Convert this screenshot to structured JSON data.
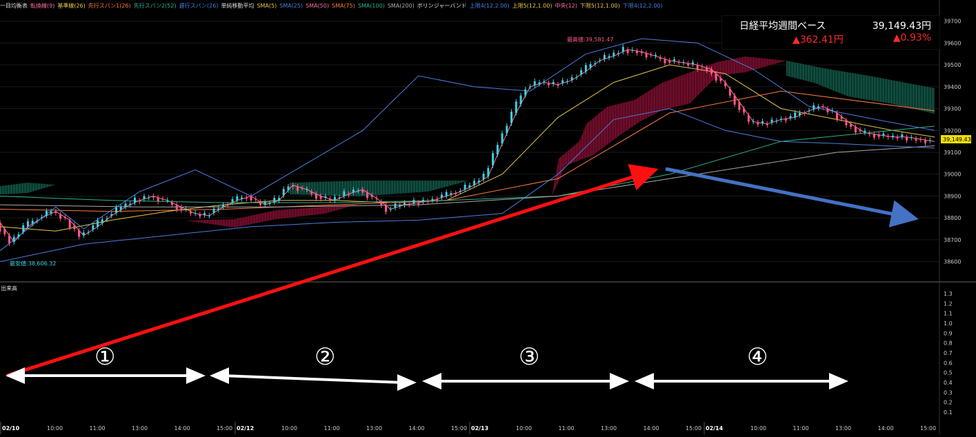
{
  "legend": [
    {
      "text": "一目均衡表",
      "color": "#dddddd"
    },
    {
      "text": "転換線(9)",
      "color": "#ff6fa0"
    },
    {
      "text": "基準線(26)",
      "color": "#e6c84a"
    },
    {
      "text": "先行スパン1(26)",
      "color": "#ff7a3c"
    },
    {
      "text": "先行スパン2(52)",
      "color": "#2fb58a"
    },
    {
      "text": "遅行スパン(26)",
      "color": "#4a7fe0"
    },
    {
      "text": "単純移動平均",
      "color": "#dddddd"
    },
    {
      "text": "SMA(5)",
      "color": "#e6c84a"
    },
    {
      "text": "SMA(25)",
      "color": "#4a7fe0"
    },
    {
      "text": "SMA(50)",
      "color": "#ff6fa0"
    },
    {
      "text": "SMA(75)",
      "color": "#ff7a3c"
    },
    {
      "text": "SMA(100)",
      "color": "#2fb58a"
    },
    {
      "text": "SMA(200)",
      "color": "#aaaaaa"
    },
    {
      "text": "ボリンジャーバンド",
      "color": "#dddddd"
    },
    {
      "text": "上限4(12,2.00)",
      "color": "#4a7fe0"
    },
    {
      "text": "上限5(12,1.00)",
      "color": "#e6c84a"
    },
    {
      "text": "中央(12)",
      "color": "#ff6fa0"
    },
    {
      "text": "下限5(12,1.00)",
      "color": "#e6c84a"
    },
    {
      "text": "下限4(12,2.00)",
      "color": "#4a7fe0"
    }
  ],
  "info": {
    "title": "日経平均週間ベース",
    "price": "39,149.43円",
    "change": "▲362.41円",
    "change_pct": "▲0.93%"
  },
  "volume_label": "出来高",
  "annotations": {
    "high": "最高値:39,581.47",
    "low": "最安値:38,606.32",
    "current": "39,149.43"
  },
  "segment_labels": [
    "①",
    "②",
    "③",
    "④"
  ],
  "chart_data": {
    "type": "line",
    "price_axis": {
      "ticks": [
        38600,
        38700,
        38800,
        38900,
        39000,
        39100,
        39200,
        39300,
        39400,
        39500,
        39600,
        39700
      ],
      "ylim": [
        38520,
        39740
      ]
    },
    "volume_axis": {
      "ticks": [
        "0.1",
        "0.2",
        "0.3",
        "0.4",
        "0.5",
        "0.6",
        "0.7",
        "0.8",
        "0.9",
        "1.0",
        "1.1",
        "1.2",
        "1.3"
      ]
    },
    "x_labels": [
      "02/10",
      "10:00",
      "11:00",
      "13:00",
      "14:00",
      "15:00",
      "02/12",
      "10:00",
      "11:00",
      "13:00",
      "14:00",
      "15:00",
      "02/13",
      "10:00",
      "11:00",
      "13:00",
      "14:00",
      "15:00",
      "02/14",
      "10:00",
      "11:00",
      "13:00",
      "14:00",
      "15:00"
    ],
    "series": [
      {
        "color": "#ff6fa0",
        "points": [
          [
            0,
            38780
          ],
          [
            1,
            38690
          ],
          [
            2,
            38760
          ],
          [
            3,
            38800
          ],
          [
            4,
            38830
          ],
          [
            5,
            38790
          ],
          [
            6,
            38720
          ],
          [
            7,
            38760
          ],
          [
            8,
            38810
          ],
          [
            9,
            38850
          ],
          [
            10,
            38880
          ],
          [
            11,
            38900
          ],
          [
            12,
            38880
          ],
          [
            13,
            38850
          ],
          [
            14,
            38820
          ],
          [
            15,
            38810
          ],
          [
            16,
            38850
          ],
          [
            17,
            38880
          ],
          [
            18,
            38900
          ],
          [
            19,
            38860
          ],
          [
            20,
            38880
          ],
          [
            21,
            38950
          ],
          [
            22,
            38930
          ],
          [
            23,
            38900
          ],
          [
            24,
            38880
          ],
          [
            25,
            38910
          ],
          [
            26,
            38930
          ],
          [
            27,
            38890
          ],
          [
            28,
            38840
          ],
          [
            29,
            38860
          ],
          [
            30,
            38870
          ],
          [
            31,
            38880
          ],
          [
            32,
            38900
          ],
          [
            33,
            38920
          ],
          [
            34,
            38950
          ],
          [
            35,
            38990
          ],
          [
            36,
            39140
          ],
          [
            37,
            39280
          ],
          [
            38,
            39400
          ],
          [
            39,
            39420
          ],
          [
            40,
            39410
          ],
          [
            41,
            39430
          ],
          [
            42,
            39470
          ],
          [
            43,
            39520
          ],
          [
            44,
            39540
          ],
          [
            45,
            39570
          ],
          [
            46,
            39560
          ],
          [
            47,
            39540
          ],
          [
            48,
            39520
          ],
          [
            49,
            39510
          ],
          [
            50,
            39500
          ],
          [
            51,
            39480
          ],
          [
            52,
            39420
          ],
          [
            53,
            39330
          ],
          [
            54,
            39240
          ],
          [
            55,
            39230
          ],
          [
            56,
            39250
          ],
          [
            57,
            39260
          ],
          [
            58,
            39290
          ],
          [
            59,
            39310
          ],
          [
            60,
            39280
          ],
          [
            61,
            39230
          ],
          [
            62,
            39190
          ],
          [
            63,
            39180
          ],
          [
            64,
            39170
          ],
          [
            65,
            39170
          ],
          [
            66,
            39160
          ],
          [
            67,
            39150
          ]
        ]
      },
      {
        "color": "#e6c84a",
        "points": [
          [
            0,
            38760
          ],
          [
            4,
            38740
          ],
          [
            8,
            38790
          ],
          [
            12,
            38830
          ],
          [
            16,
            38860
          ],
          [
            20,
            38880
          ],
          [
            24,
            38880
          ],
          [
            28,
            38870
          ],
          [
            32,
            38880
          ],
          [
            36,
            39000
          ],
          [
            40,
            39260
          ],
          [
            44,
            39420
          ],
          [
            48,
            39500
          ],
          [
            52,
            39460
          ],
          [
            56,
            39300
          ],
          [
            60,
            39250
          ],
          [
            64,
            39200
          ],
          [
            67,
            39170
          ]
        ]
      },
      {
        "color": "#ff7a3c",
        "points": [
          [
            0,
            38840
          ],
          [
            8,
            38830
          ],
          [
            16,
            38840
          ],
          [
            24,
            38860
          ],
          [
            32,
            38880
          ],
          [
            40,
            38980
          ],
          [
            48,
            39280
          ],
          [
            56,
            39380
          ],
          [
            67,
            39290
          ]
        ]
      },
      {
        "color": "#2fb58a",
        "points": [
          [
            0,
            38900
          ],
          [
            8,
            38880
          ],
          [
            16,
            38870
          ],
          [
            24,
            38870
          ],
          [
            32,
            38880
          ],
          [
            40,
            38900
          ],
          [
            48,
            39000
          ],
          [
            56,
            39150
          ],
          [
            67,
            39220
          ]
        ]
      },
      {
        "color": "#aaaaaa",
        "points": [
          [
            0,
            38860
          ],
          [
            10,
            38850
          ],
          [
            20,
            38850
          ],
          [
            30,
            38860
          ],
          [
            40,
            38900
          ],
          [
            48,
            38980
          ],
          [
            54,
            39040
          ],
          [
            60,
            39100
          ],
          [
            67,
            39130
          ]
        ]
      },
      {
        "color": "#4a7fe0",
        "points": [
          [
            0,
            38650
          ],
          [
            4,
            38850
          ],
          [
            6,
            38750
          ],
          [
            10,
            38920
          ],
          [
            14,
            39020
          ],
          [
            18,
            38900
          ],
          [
            22,
            39050
          ],
          [
            26,
            39200
          ],
          [
            30,
            39450
          ],
          [
            34,
            39400
          ],
          [
            38,
            39380
          ],
          [
            42,
            39550
          ],
          [
            46,
            39620
          ],
          [
            50,
            39600
          ],
          [
            54,
            39480
          ],
          [
            58,
            39310
          ],
          [
            62,
            39260
          ],
          [
            67,
            39200
          ]
        ]
      },
      {
        "color": "#4a7fe0",
        "points": [
          [
            0,
            38600
          ],
          [
            6,
            38680
          ],
          [
            12,
            38720
          ],
          [
            18,
            38760
          ],
          [
            24,
            38780
          ],
          [
            30,
            38790
          ],
          [
            36,
            38820
          ],
          [
            40,
            39000
          ],
          [
            44,
            39250
          ],
          [
            48,
            39300
          ],
          [
            52,
            39200
          ],
          [
            56,
            39150
          ],
          [
            60,
            39140
          ],
          [
            67,
            39120
          ]
        ]
      }
    ]
  }
}
